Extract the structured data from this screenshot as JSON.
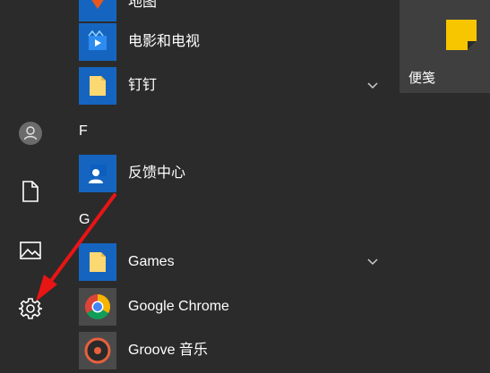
{
  "apps": {
    "top_partial": {
      "name": "地图",
      "icon": "maps-icon"
    },
    "movies": {
      "name": "电影和电视",
      "icon": "movies-tv-icon"
    },
    "dingtalk": {
      "name": "钉钉",
      "icon": "folder-icon"
    },
    "section_f": "F",
    "feedback": {
      "name": "反馈中心",
      "icon": "feedback-hub-icon"
    },
    "section_g": "G",
    "games": {
      "name": "Games",
      "icon": "folder-icon"
    },
    "chrome": {
      "name": "Google Chrome",
      "icon": "chrome-icon"
    },
    "groove": {
      "name": "Groove 音乐",
      "icon": "groove-music-icon"
    }
  },
  "tiles": {
    "sticky_notes": {
      "label": "便笺",
      "icon": "sticky-notes-icon"
    }
  },
  "rail": {
    "items": [
      "user-icon",
      "documents-icon",
      "pictures-icon",
      "settings-icon"
    ]
  },
  "colors": {
    "background": "#2b2b2b",
    "app_tile_blue": "#1565c0",
    "sticky_yellow": "#f7c600",
    "annotation_red": "#e81515"
  }
}
